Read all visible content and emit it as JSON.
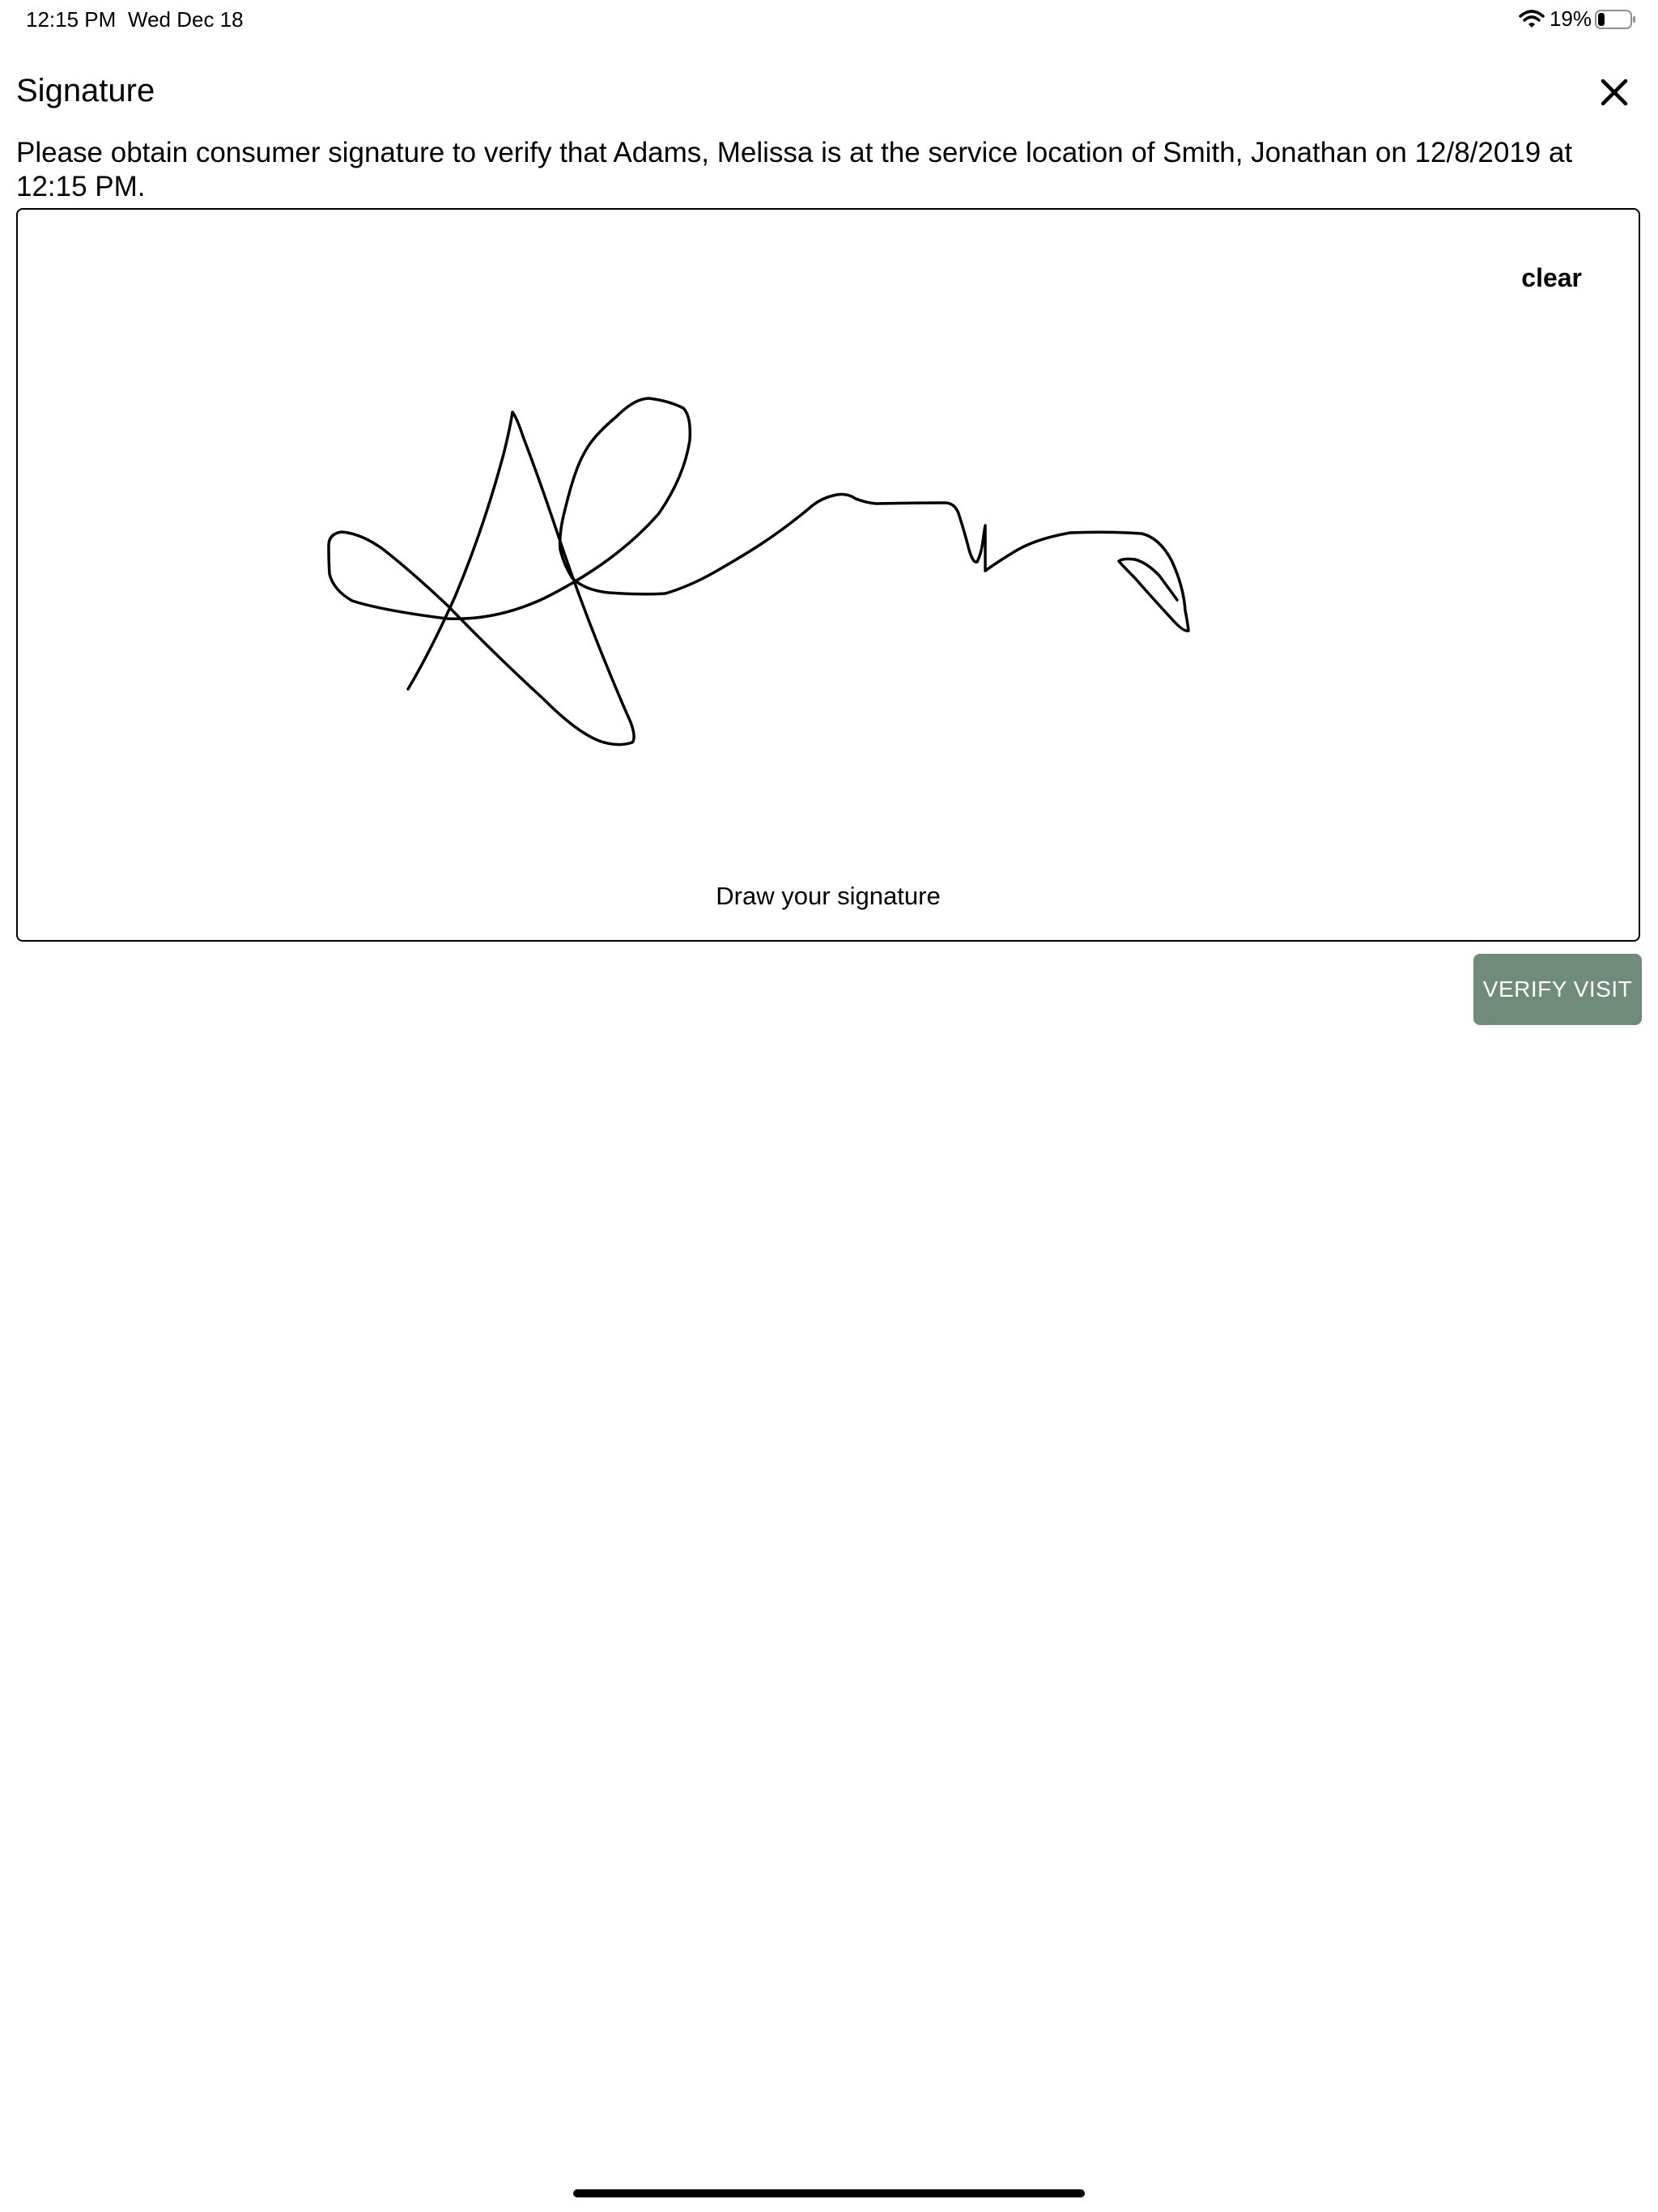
{
  "status_bar": {
    "time": "12:15 PM",
    "date": "Wed Dec 18",
    "battery_percent": "19%",
    "battery_level": 0.19,
    "icons": [
      "wifi-icon",
      "battery-icon"
    ]
  },
  "header": {
    "title": "Signature",
    "close_icon": "close-icon"
  },
  "instructions": "Please obtain consumer signature to verify that Adams, Melissa is at the service location of Smith, Jonathan on 12/8/2019 at 12:15 PM.",
  "signature_pad": {
    "clear_label": "clear",
    "hint": "Draw your signature"
  },
  "actions": {
    "verify_label": "VERIFY VISIT"
  },
  "colors": {
    "verify_button": "#6E8C79",
    "text": "#000000",
    "background": "#FFFFFF"
  }
}
